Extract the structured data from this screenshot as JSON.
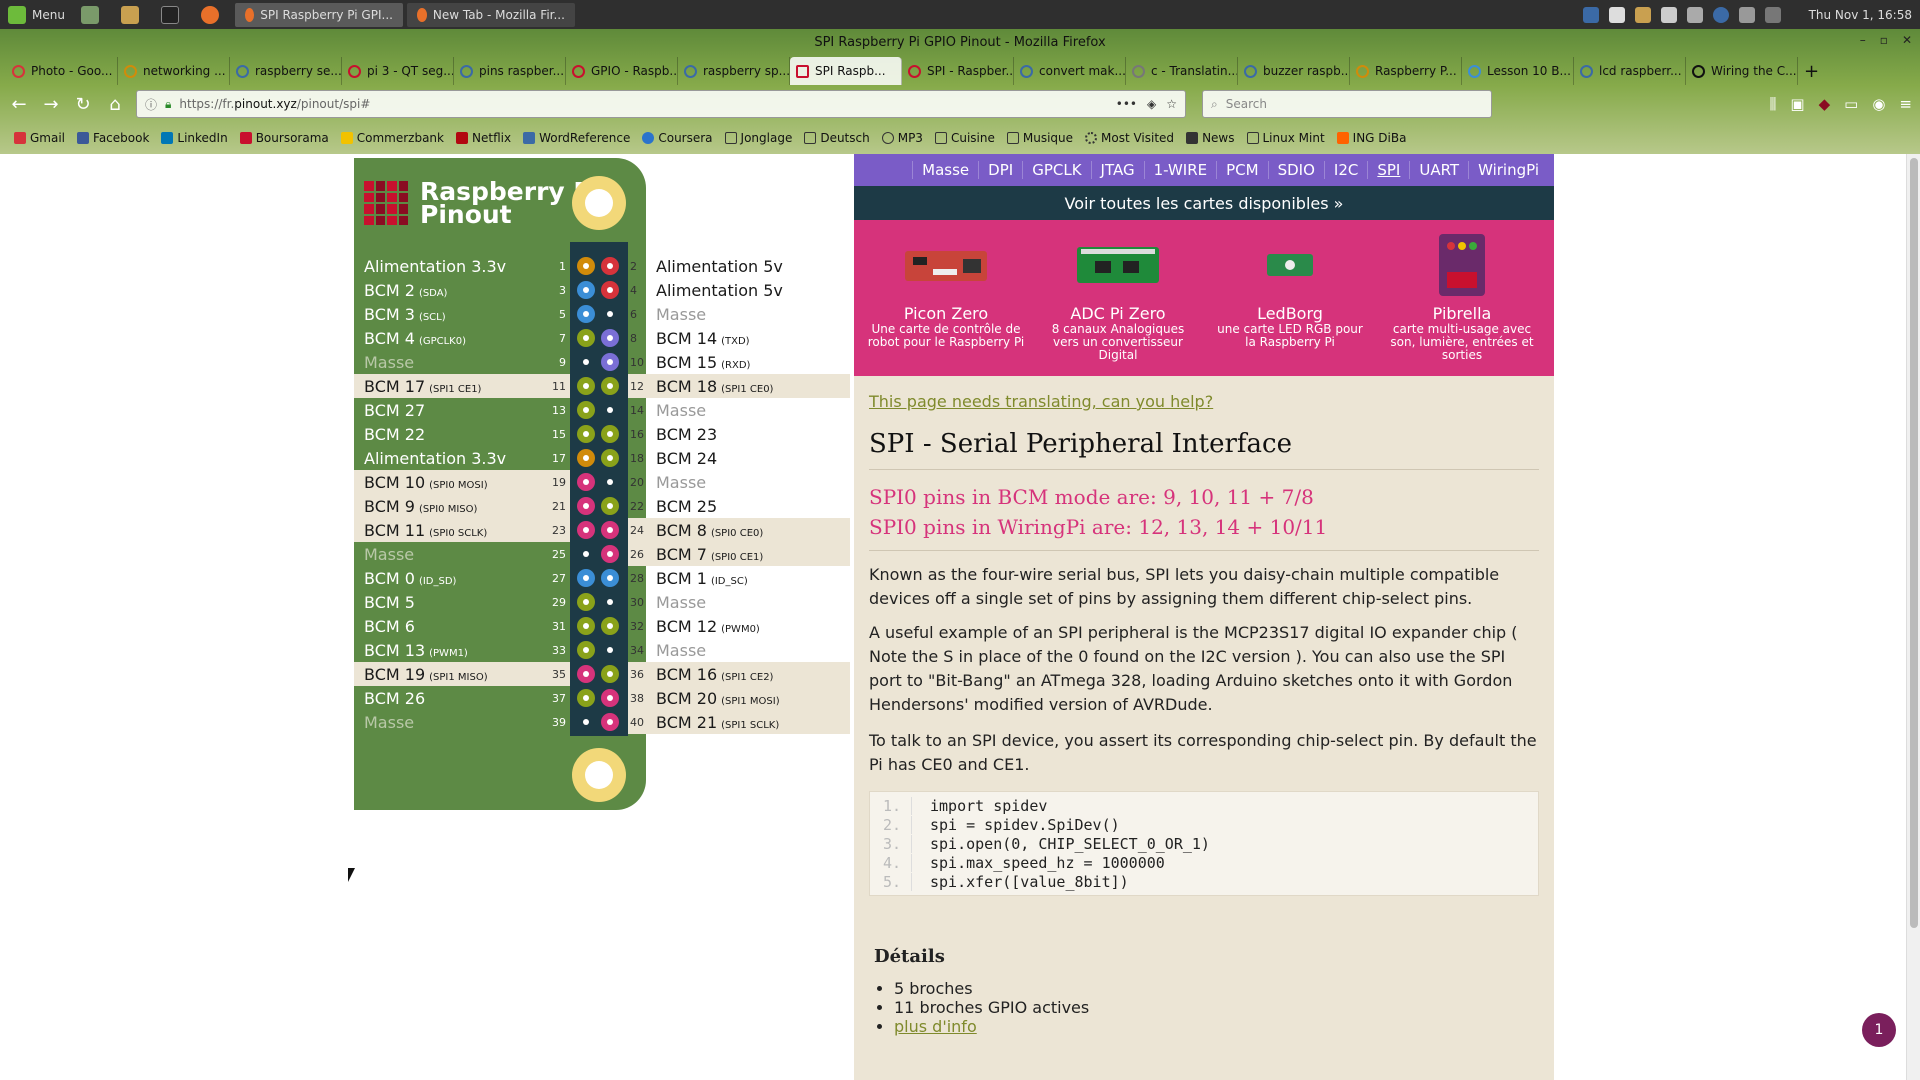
{
  "taskbar": {
    "menu_label": "Menu",
    "tasks": [
      "SPI Raspberry Pi GPI...",
      "New Tab - Mozilla Fir..."
    ],
    "clock": "Thu Nov  1, 16:58"
  },
  "window": {
    "title": "SPI Raspberry Pi GPIO Pinout - Mozilla Firefox"
  },
  "tabs": [
    "Photo - Goo...",
    "networking ...",
    "raspberry se...",
    "pi 3 - QT seg...",
    "pins raspber...",
    "GPIO - Raspb...",
    "raspberry sp...",
    "SPI Raspb...",
    "SPI - Raspber...",
    "convert mak...",
    "c - Translatin...",
    "buzzer raspb...",
    "Raspberry P...",
    "Lesson 10 B...",
    "lcd raspberr...",
    "Wiring the C..."
  ],
  "url": {
    "prefix": "https://fr.",
    "domain": "pinout.xyz",
    "path": "/pinout/spi#"
  },
  "search_placeholder": "Search",
  "bookmarks": [
    "Gmail",
    "Facebook",
    "LinkedIn",
    "Boursorama",
    "Commerzbank",
    "Netflix",
    "WordReference",
    "Coursera",
    "Jonglage",
    "Deutsch",
    "MP3",
    "Cuisine",
    "Musique",
    "Most Visited",
    "News",
    "Linux Mint",
    "ING DiBa"
  ],
  "board": {
    "title1": "Raspberry Pi",
    "title2": "Pinout"
  },
  "pins_left": [
    {
      "n": "1",
      "label": "Alimentation 3.3v",
      "sub": "",
      "color": "#d18b0a"
    },
    {
      "n": "3",
      "label": "BCM 2",
      "sub": "(SDA)",
      "color": "#3b8ed6"
    },
    {
      "n": "5",
      "label": "BCM 3",
      "sub": "(SCL)",
      "color": "#3b8ed6"
    },
    {
      "n": "7",
      "label": "BCM 4",
      "sub": "(GPCLK0)",
      "color": "#8aa21a"
    },
    {
      "n": "9",
      "label": "Masse",
      "sub": "",
      "color": "#1d3a46"
    },
    {
      "n": "11",
      "label": "BCM 17",
      "sub": "(SPI1 CE1)",
      "color": "#8aa21a"
    },
    {
      "n": "13",
      "label": "BCM 27",
      "sub": "",
      "color": "#8aa21a"
    },
    {
      "n": "15",
      "label": "BCM 22",
      "sub": "",
      "color": "#8aa21a"
    },
    {
      "n": "17",
      "label": "Alimentation 3.3v",
      "sub": "",
      "color": "#d18b0a"
    },
    {
      "n": "19",
      "label": "BCM 10",
      "sub": "(SPI0 MOSI)",
      "color": "#d6337b"
    },
    {
      "n": "21",
      "label": "BCM 9",
      "sub": "(SPI0 MISO)",
      "color": "#d6337b"
    },
    {
      "n": "23",
      "label": "BCM 11",
      "sub": "(SPI0 SCLK)",
      "color": "#d6337b"
    },
    {
      "n": "25",
      "label": "Masse",
      "sub": "",
      "color": "#1d3a46"
    },
    {
      "n": "27",
      "label": "BCM 0",
      "sub": "(ID_SD)",
      "color": "#3b8ed6"
    },
    {
      "n": "29",
      "label": "BCM 5",
      "sub": "",
      "color": "#8aa21a"
    },
    {
      "n": "31",
      "label": "BCM 6",
      "sub": "",
      "color": "#8aa21a"
    },
    {
      "n": "33",
      "label": "BCM 13",
      "sub": "(PWM1)",
      "color": "#8aa21a"
    },
    {
      "n": "35",
      "label": "BCM 19",
      "sub": "(SPI1 MISO)",
      "color": "#d6337b"
    },
    {
      "n": "37",
      "label": "BCM 26",
      "sub": "",
      "color": "#8aa21a"
    },
    {
      "n": "39",
      "label": "Masse",
      "sub": "",
      "color": "#1d3a46"
    }
  ],
  "pins_right": [
    {
      "n": "2",
      "label": "Alimentation 5v",
      "sub": "",
      "color": "#d6333b"
    },
    {
      "n": "4",
      "label": "Alimentation 5v",
      "sub": "",
      "color": "#d6333b"
    },
    {
      "n": "6",
      "label": "Masse",
      "sub": "",
      "color": "#1d3a46"
    },
    {
      "n": "8",
      "label": "BCM 14",
      "sub": "(TXD)",
      "color": "#7a6fd6"
    },
    {
      "n": "10",
      "label": "BCM 15",
      "sub": "(RXD)",
      "color": "#7a6fd6"
    },
    {
      "n": "12",
      "label": "BCM 18",
      "sub": "(SPI1 CE0)",
      "color": "#8aa21a"
    },
    {
      "n": "14",
      "label": "Masse",
      "sub": "",
      "color": "#1d3a46"
    },
    {
      "n": "16",
      "label": "BCM 23",
      "sub": "",
      "color": "#8aa21a"
    },
    {
      "n": "18",
      "label": "BCM 24",
      "sub": "",
      "color": "#8aa21a"
    },
    {
      "n": "20",
      "label": "Masse",
      "sub": "",
      "color": "#1d3a46"
    },
    {
      "n": "22",
      "label": "BCM 25",
      "sub": "",
      "color": "#8aa21a"
    },
    {
      "n": "24",
      "label": "BCM 8",
      "sub": "(SPI0 CE0)",
      "color": "#d6337b"
    },
    {
      "n": "26",
      "label": "BCM 7",
      "sub": "(SPI0 CE1)",
      "color": "#d6337b"
    },
    {
      "n": "28",
      "label": "BCM 1",
      "sub": "(ID_SC)",
      "color": "#3b8ed6"
    },
    {
      "n": "30",
      "label": "Masse",
      "sub": "",
      "color": "#1d3a46"
    },
    {
      "n": "32",
      "label": "BCM 12",
      "sub": "(PWM0)",
      "color": "#8aa21a"
    },
    {
      "n": "34",
      "label": "Masse",
      "sub": "",
      "color": "#1d3a46"
    },
    {
      "n": "36",
      "label": "BCM 16",
      "sub": "(SPI1 CE2)",
      "color": "#8aa21a"
    },
    {
      "n": "38",
      "label": "BCM 20",
      "sub": "(SPI1 MOSI)",
      "color": "#d6337b"
    },
    {
      "n": "40",
      "label": "BCM 21",
      "sub": "(SPI1 SCLK)",
      "color": "#d6337b"
    }
  ],
  "menu": [
    "Masse",
    "DPI",
    "GPCLK",
    "JTAG",
    "1-WIRE",
    "PCM",
    "SDIO",
    "I2C",
    "SPI",
    "UART",
    "WiringPi"
  ],
  "boards_link": "Voir toutes les cartes disponibles »",
  "products": [
    {
      "name": "Picon Zero",
      "desc": "Une carte de contrôle de robot pour le Raspberry Pi"
    },
    {
      "name": "ADC Pi Zero",
      "desc": "8 canaux Analogiques vers un convertisseur Digital"
    },
    {
      "name": "LedBorg",
      "desc": "une carte LED RGB pour la Raspberry Pi"
    },
    {
      "name": "Pibrella",
      "desc": "carte multi-usage avec son, lumière, entrées et sorties"
    }
  ],
  "content": {
    "translate": "This page needs translating, can you help?",
    "title": "SPI - Serial Peripheral Interface",
    "h3a": "SPI0 pins in BCM mode are: 9, 10, 11 + 7/8",
    "h3b": "SPI0 pins in WiringPi are: 12, 13, 14 + 10/11",
    "p1": "Known as the four-wire serial bus, SPI lets you daisy-chain multiple compatible devices off a single set of pins by assigning them different chip-select pins.",
    "p2": "A useful example of an SPI peripheral is the MCP23S17 digital IO expander chip ( Note the S in place of the 0 found on the I2C version ). You can also use the SPI port to \"Bit-Bang\" an ATmega 328, loading Arduino sketches onto it with Gordon Hendersons' modified version of AVRDude.",
    "p3": "To talk to an SPI device, you assert its corresponding chip-select pin. By default the Pi has CE0 and CE1."
  },
  "code": [
    "import spidev",
    "spi = spidev.SpiDev()",
    "spi.open(0, CHIP_SELECT_0_OR_1)",
    "spi.max_speed_hz = 1000000",
    "spi.xfer([value_8bit])"
  ],
  "details": {
    "title": "Détails",
    "items": [
      "5 broches",
      "11 broches GPIO actives"
    ],
    "link": "plus d'info"
  },
  "badge": "1"
}
